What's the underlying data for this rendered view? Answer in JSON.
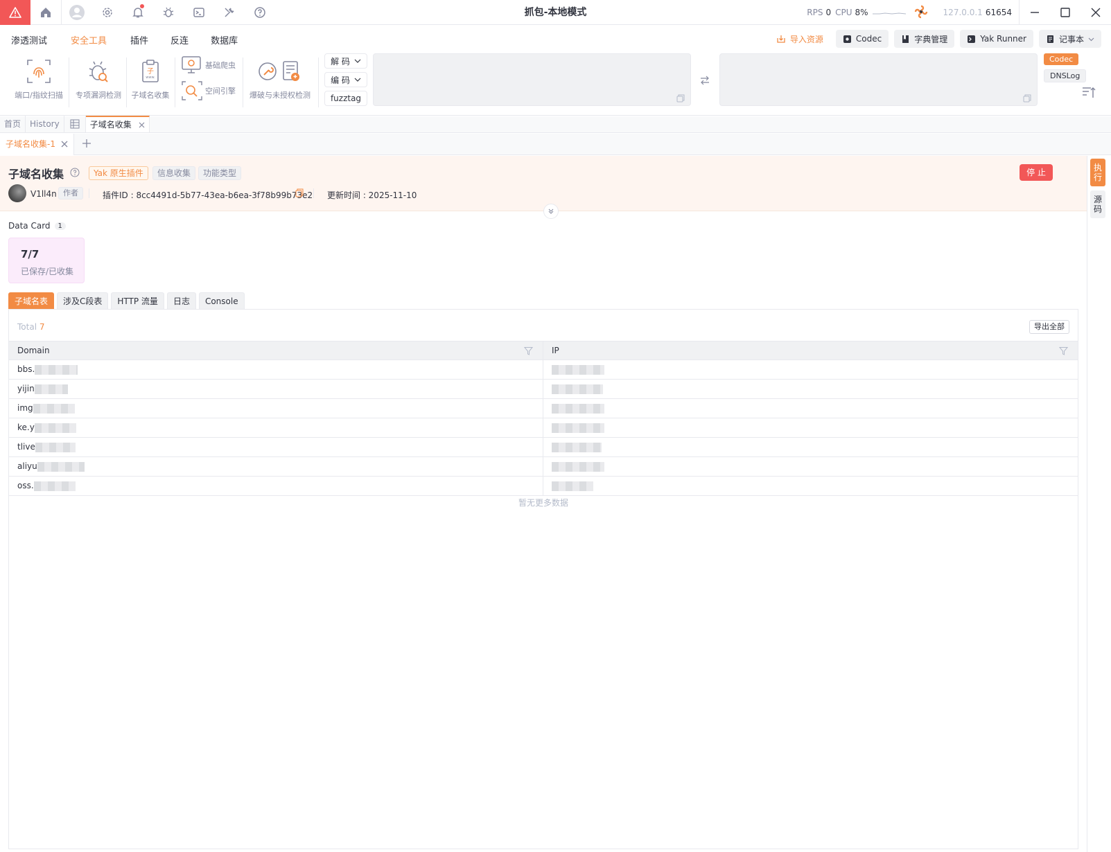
{
  "titlebar": {
    "title": "抓包-本地模式",
    "rps_label": "RPS",
    "rps_value": "0",
    "cpu_label": "CPU",
    "cpu_value": "8%",
    "address": "127.0.0.1",
    "port": "61654"
  },
  "menu": {
    "items": [
      "渗透测试",
      "安全工具",
      "插件",
      "反连",
      "数据库"
    ],
    "active_index": 1,
    "import_label": "导入资源",
    "codec_label": "Codec",
    "dict_label": "字典管理",
    "yak_runner_label": "Yak Runner",
    "notebook_label": "记事本"
  },
  "toolbar": {
    "tools": [
      "端口/指纹扫描",
      "专项漏洞检测",
      "子域名收集"
    ],
    "crawler_label": "基础爬虫",
    "space_engine_label": "空间引擎",
    "brute_label": "爆破与未授权检测",
    "decode_label": "解 码",
    "encode_label": "编 码",
    "fuzztag_label": "fuzztag",
    "side_codec": "Codec",
    "side_dnslog": "DNSLog"
  },
  "tabs1": {
    "home": "首页",
    "history": "History",
    "current": "子域名收集"
  },
  "tabs2": {
    "current": "子域名收集-1"
  },
  "plugin": {
    "title": "子域名收集",
    "tags": [
      "Yak 原生插件",
      "信息收集",
      "功能类型"
    ],
    "stop_label": "停 止",
    "author": "V1ll4n",
    "author_tag": "作者",
    "plugin_id": "插件ID : 8cc4491d-5b77-43ea-b6ea-3f78b99b73e2",
    "updated": "更新时间 : 2025-11-10"
  },
  "rail": {
    "execute": "执行",
    "source": "源码"
  },
  "data_card": {
    "title": "Data Card",
    "count": "1",
    "value": "7/7",
    "label": "已保存/已收集"
  },
  "result_tabs": [
    "子域名表",
    "涉及C段表",
    "HTTP 流量",
    "日志",
    "Console"
  ],
  "table": {
    "total_label": "Total",
    "total_value": "7",
    "export_label": "导出全部",
    "columns": [
      "Domain",
      "IP"
    ],
    "rows": [
      {
        "domain": "bbs.",
        "ip": ""
      },
      {
        "domain": "yijin",
        "ip": ""
      },
      {
        "domain": "img",
        "ip": ""
      },
      {
        "domain": "ke.y",
        "ip": ""
      },
      {
        "domain": "tlive",
        "ip": ""
      },
      {
        "domain": "aliyu",
        "ip": ""
      },
      {
        "domain": "oss.",
        "ip": ""
      }
    ],
    "no_more": "暂无更多数据"
  },
  "colors": {
    "accent": "#f28b44",
    "danger": "#f25757"
  }
}
